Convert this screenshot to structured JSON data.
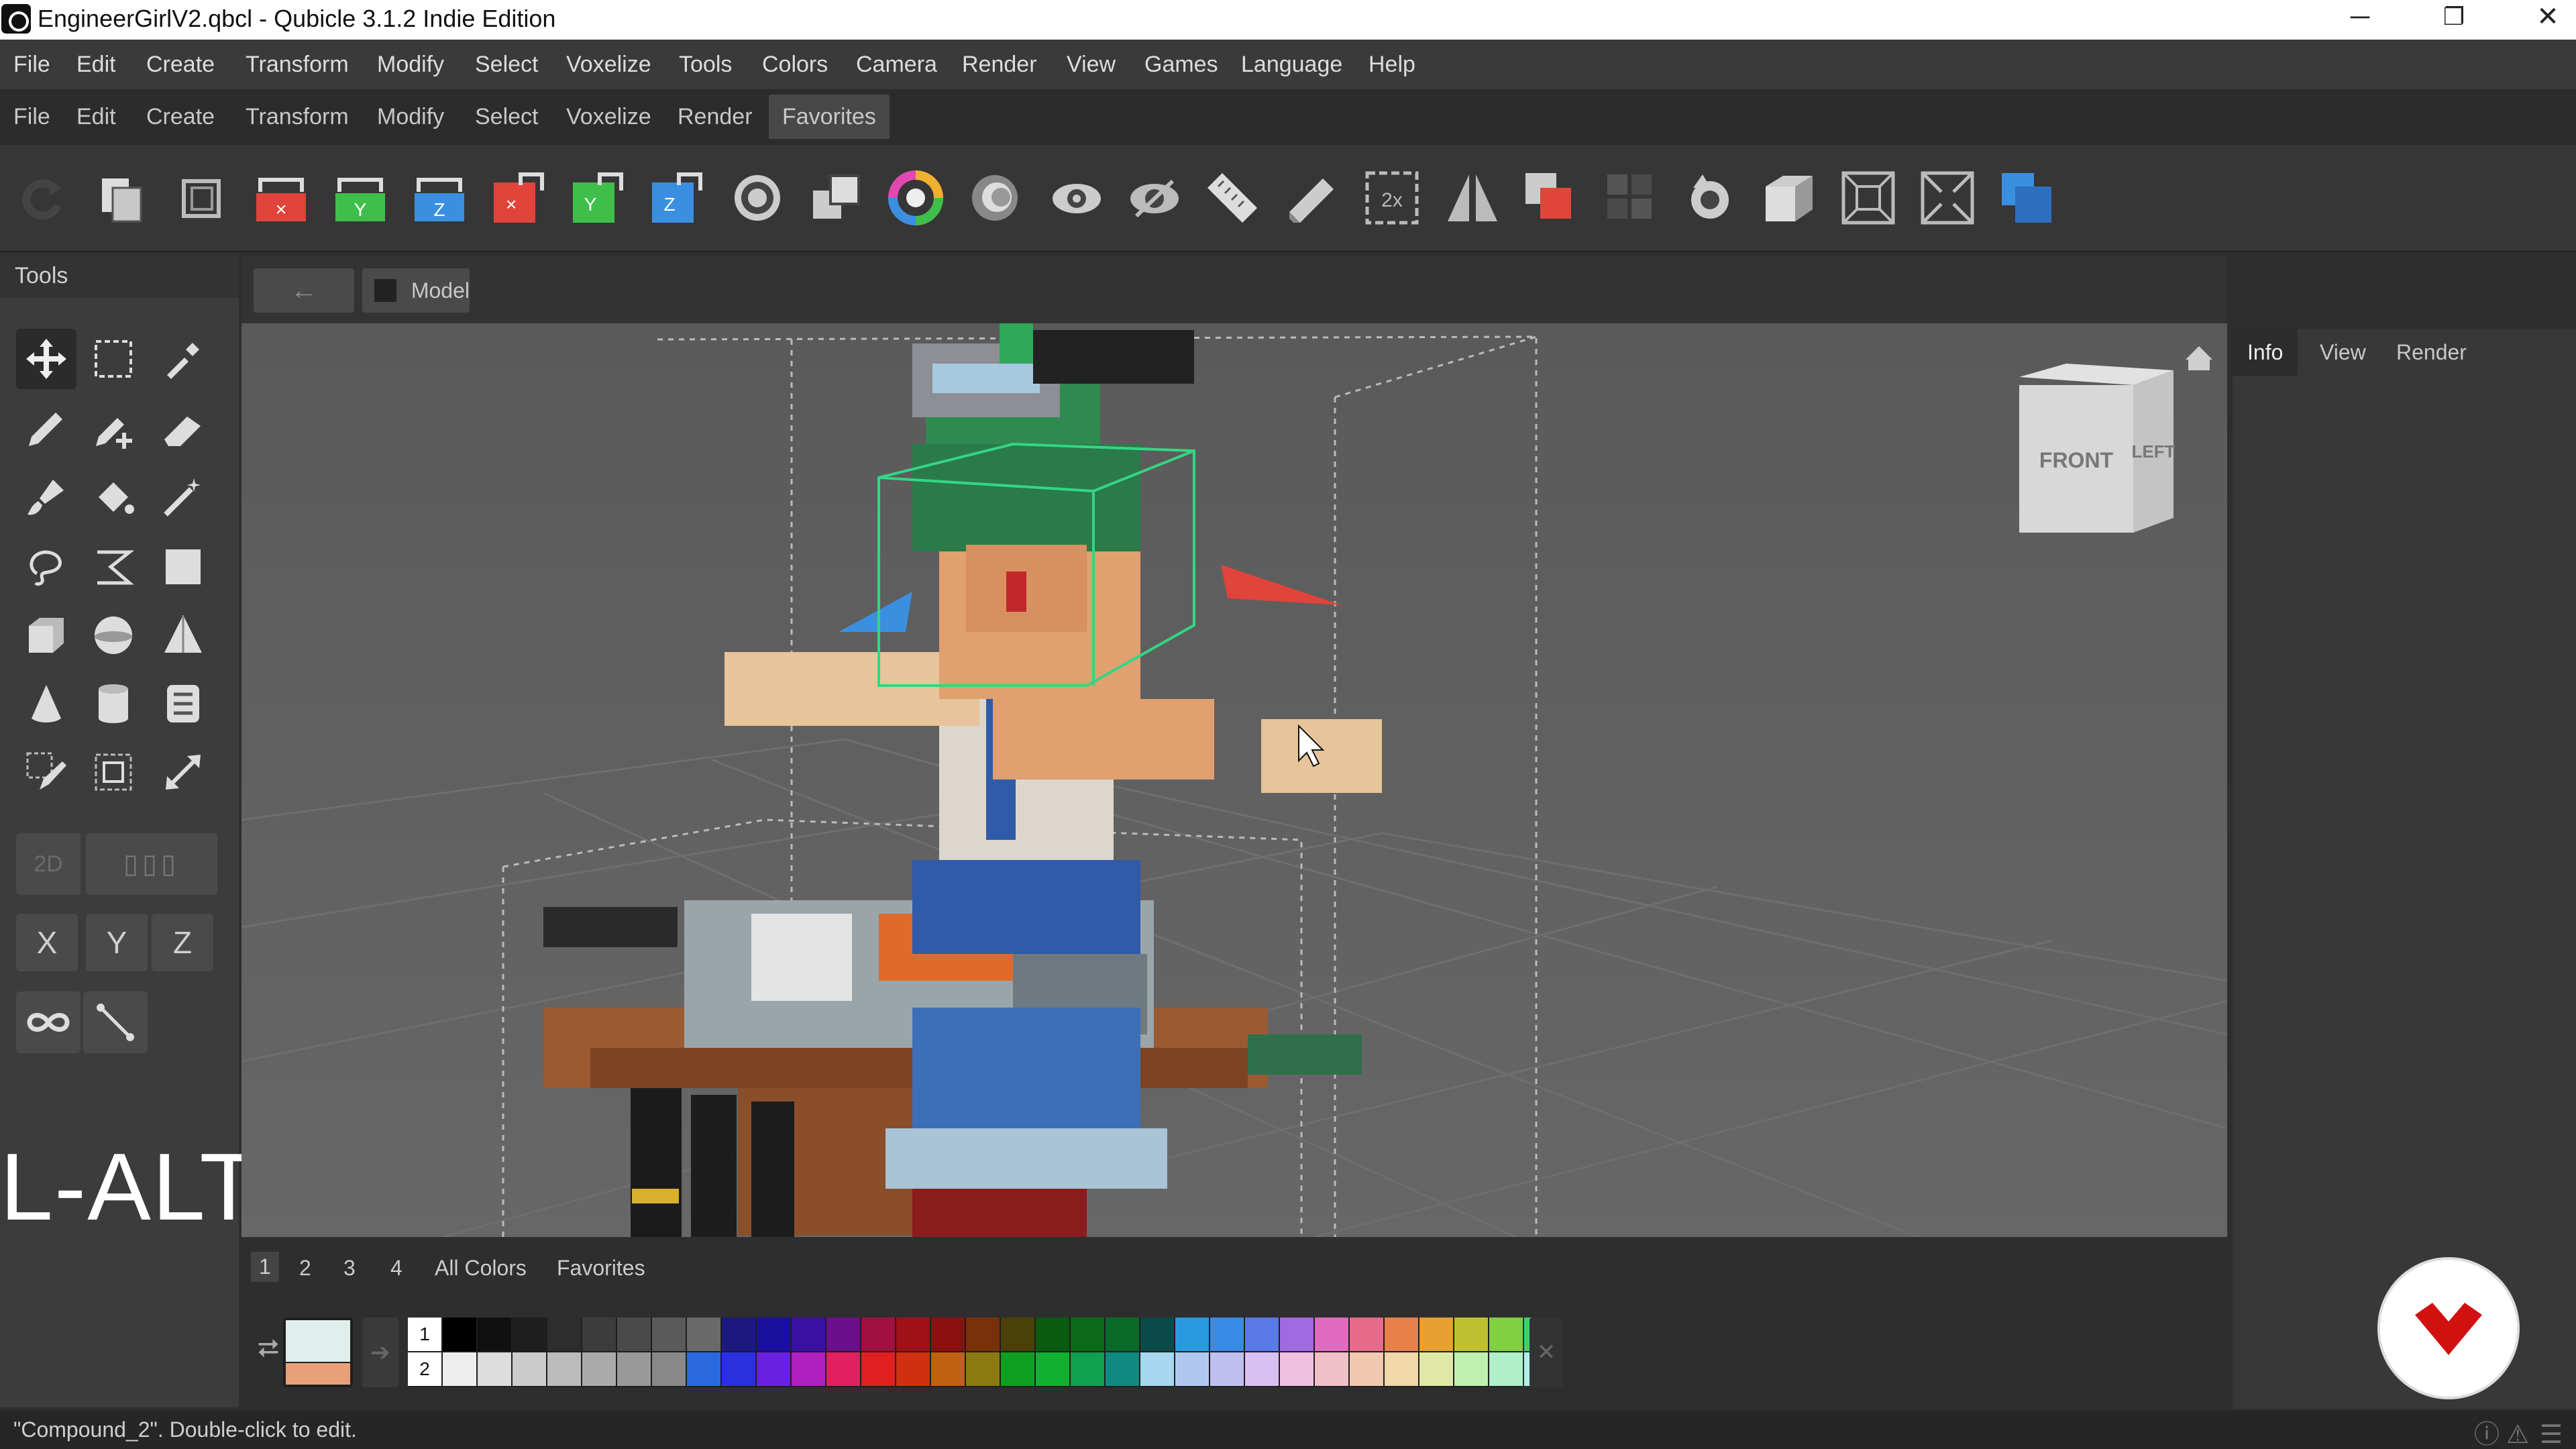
{
  "window": {
    "title": "EngineerGirlV2.qbcl - Qubicle 3.1.2 Indie Edition",
    "minimize": "─",
    "restore": "❐",
    "close": "✕"
  },
  "menubar": [
    "File",
    "Edit",
    "Create",
    "Transform",
    "Modify",
    "Select",
    "Voxelize",
    "Tools",
    "Colors",
    "Camera",
    "Render",
    "View",
    "Games",
    "Language",
    "Help"
  ],
  "menubar2": [
    "File",
    "Edit",
    "Create",
    "Transform",
    "Modify",
    "Select",
    "Voxelize",
    "Render",
    "Favorites"
  ],
  "tools_panel": {
    "title": "Tools",
    "axes": [
      "X",
      "Y",
      "Z"
    ],
    "overlay_key": "L-ALT"
  },
  "viewport": {
    "back": "←",
    "breadcrumb": "Model",
    "cube_front": "FRONT",
    "cube_left": "LEFT"
  },
  "right_panel": {
    "tabs": [
      "Info",
      "View",
      "Render"
    ]
  },
  "palette": {
    "tabs": [
      "1",
      "2",
      "3",
      "4",
      "All Colors",
      "Favorites"
    ],
    "rows": [
      "1",
      "2"
    ]
  },
  "status": {
    "message": "\"Compound_2\". Double-click to edit."
  },
  "colors": {
    "red_axis": "#e0443a",
    "green_axis": "#3fbf4a",
    "blue_axis": "#3b8fe0",
    "selection": "#34d683",
    "accent_record": "#d11010"
  }
}
